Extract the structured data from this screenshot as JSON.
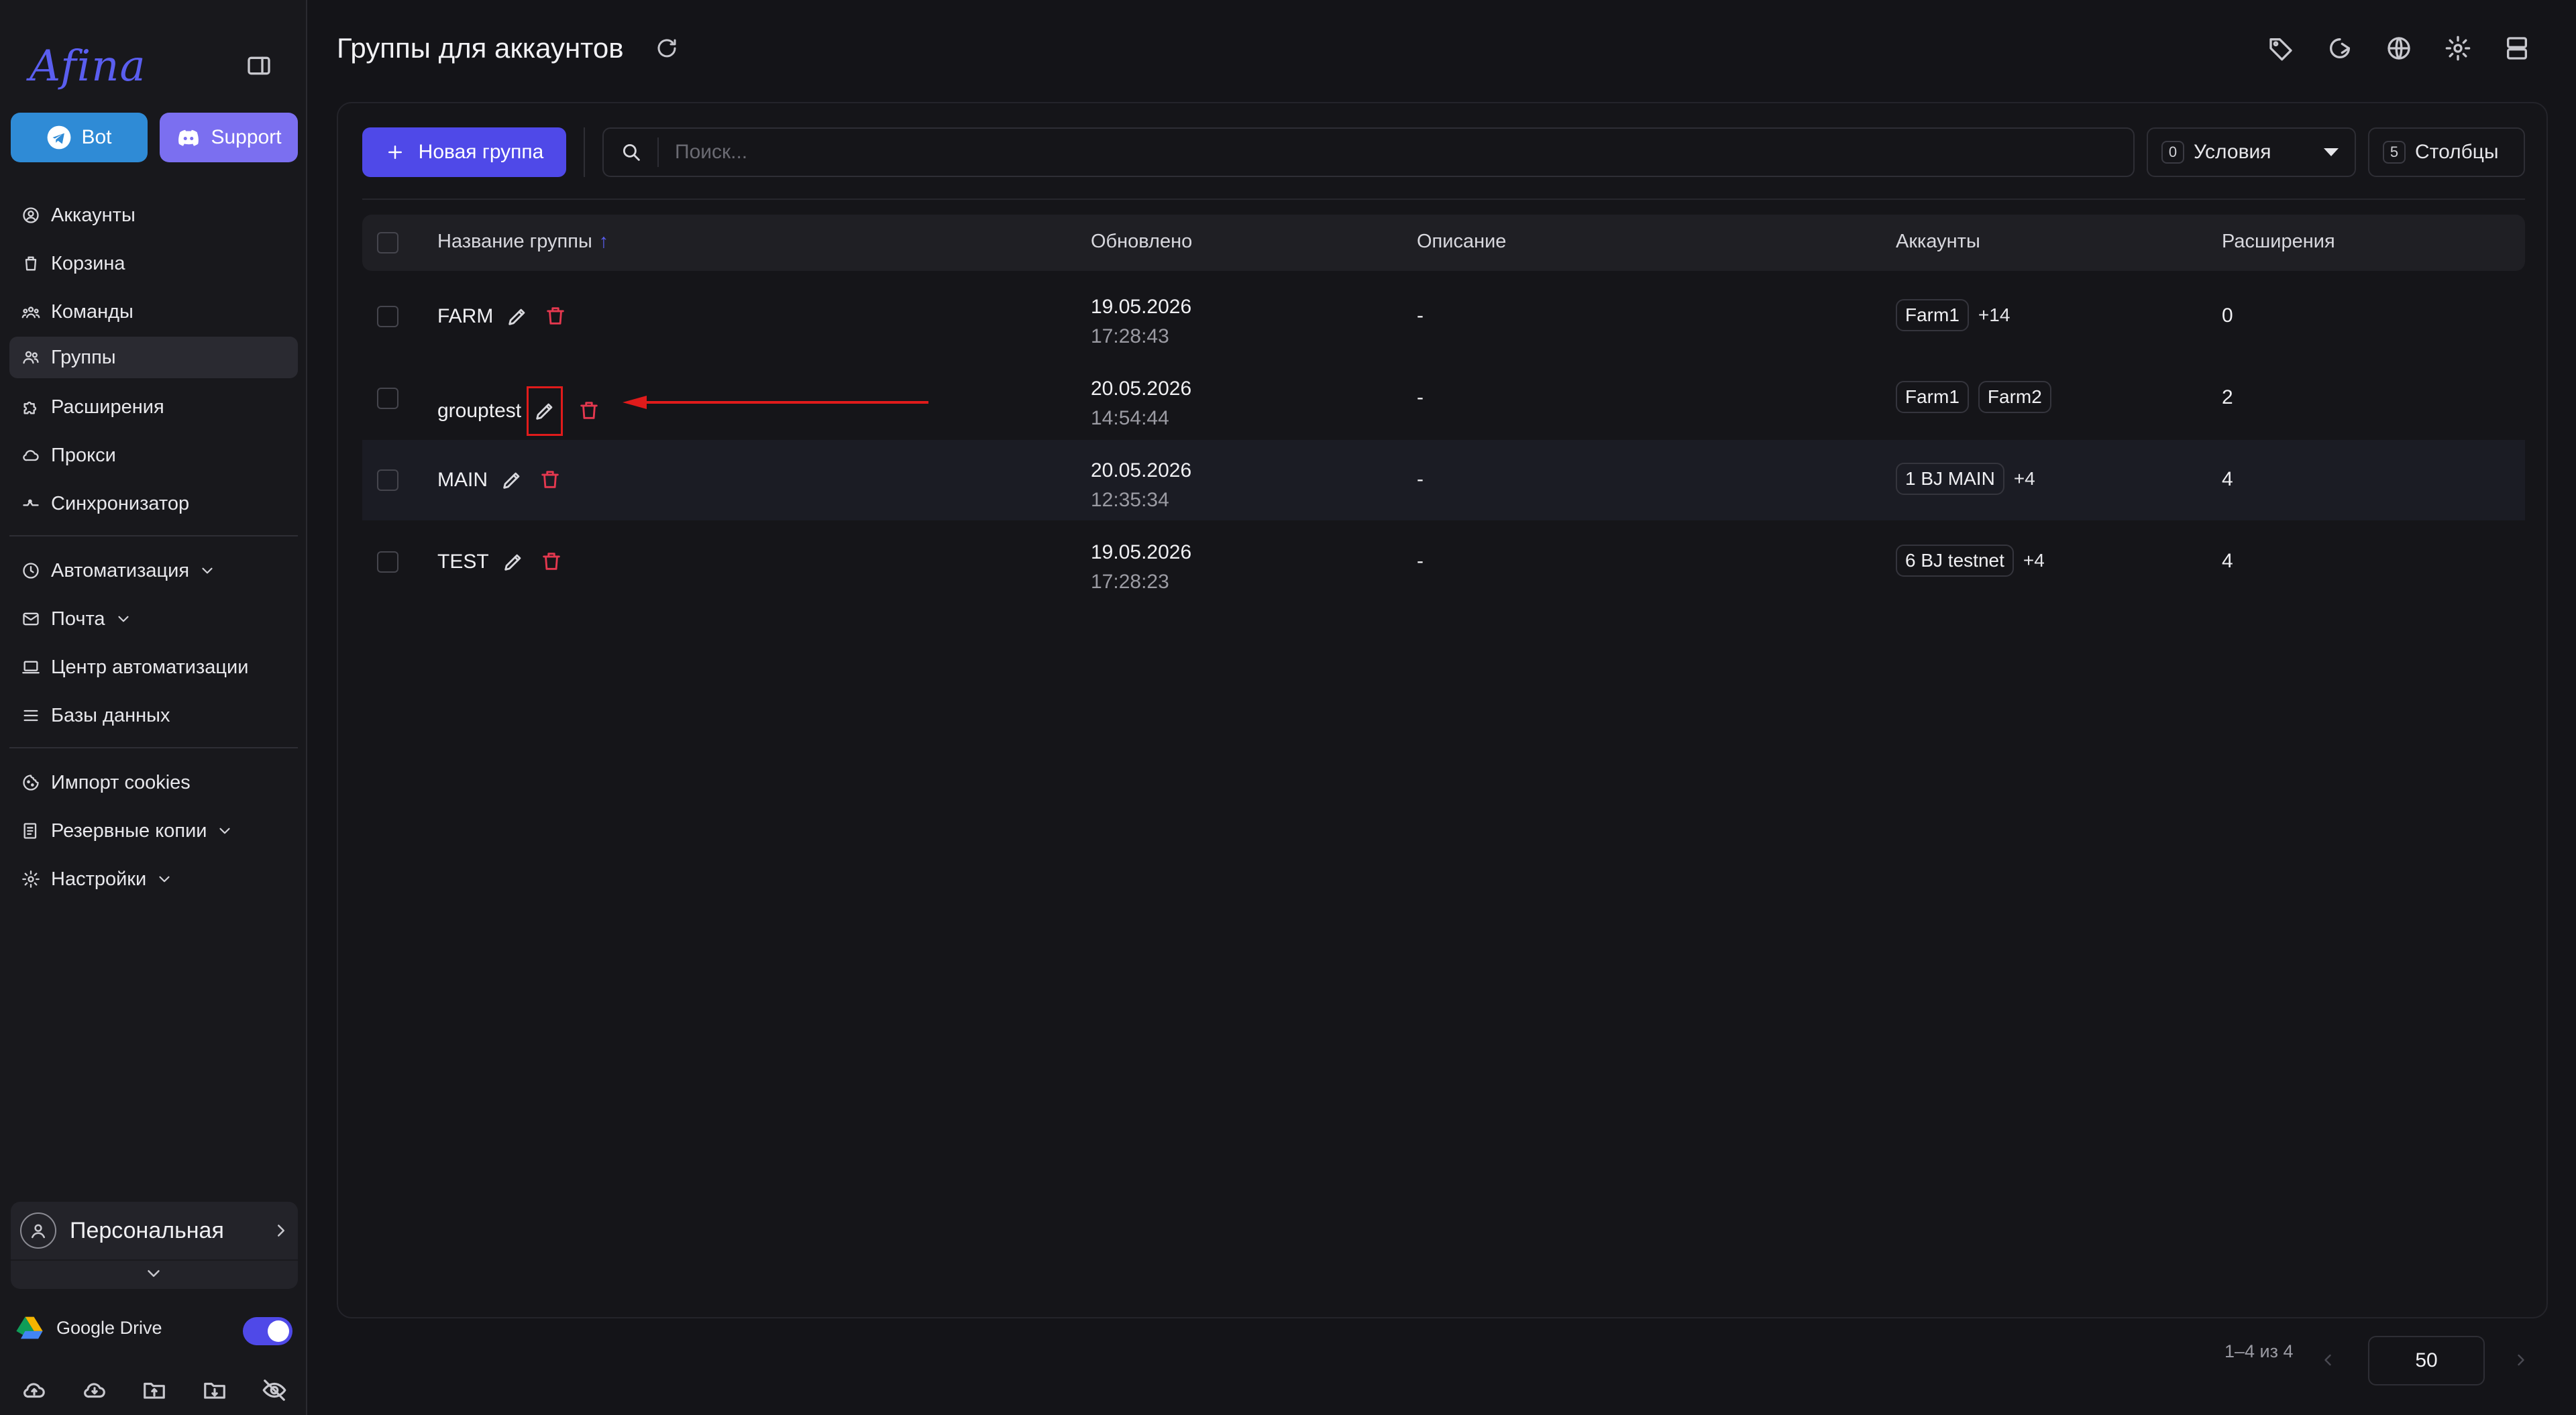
{
  "app": {
    "logo_text": "Afina",
    "bot_label": "Bot",
    "support_label": "Support"
  },
  "sidebar": {
    "items": [
      {
        "label": "Аккаунты",
        "icon": "user-circle-icon"
      },
      {
        "label": "Корзина",
        "icon": "trash-icon"
      },
      {
        "label": "Команды",
        "icon": "team-icon"
      },
      {
        "label": "Группы",
        "icon": "users-icon",
        "active": true
      },
      {
        "label": "Расширения",
        "icon": "puzzle-icon"
      },
      {
        "label": "Прокси",
        "icon": "cloud-icon"
      },
      {
        "label": "Синхронизатор",
        "icon": "sync-icon"
      },
      {
        "label": "Автоматизация",
        "icon": "automation-icon",
        "expandable": true
      },
      {
        "label": "Почта",
        "icon": "mail-icon",
        "expandable": true
      },
      {
        "label": "Центр автоматизации",
        "icon": "laptop-icon"
      },
      {
        "label": "Базы данных",
        "icon": "list-icon"
      },
      {
        "label": "Импорт cookies",
        "icon": "cookie-icon"
      },
      {
        "label": "Резервные копии",
        "icon": "backup-icon",
        "expandable": true
      },
      {
        "label": "Настройки",
        "icon": "gear-icon",
        "expandable": true
      }
    ],
    "profile_name": "Персональная",
    "gdrive_label": "Google Drive",
    "gdrive_enabled": true
  },
  "header": {
    "title": "Группы для аккаунтов"
  },
  "toolbar": {
    "new_group_label": "Новая группа",
    "search_placeholder": "Поиск...",
    "conditions_count": "0",
    "conditions_label": "Условия",
    "columns_count": "5",
    "columns_label": "Столбцы"
  },
  "table": {
    "columns": [
      "Название группы",
      "Обновлено",
      "Описание",
      "Аккаунты",
      "Расширения"
    ],
    "sort_indicator": "↑",
    "rows": [
      {
        "name": "FARM",
        "date": "19.05.2026",
        "time": "17:28:43",
        "description": "-",
        "accounts": [
          "Farm1"
        ],
        "more": "+14",
        "extensions": "0"
      },
      {
        "name": "grouptest",
        "date": "20.05.2026",
        "time": "14:54:44",
        "description": "-",
        "accounts": [
          "Farm1",
          "Farm2"
        ],
        "more": "",
        "extensions": "2"
      },
      {
        "name": "MAIN",
        "date": "20.05.2026",
        "time": "12:35:34",
        "description": "-",
        "accounts": [
          "1 BJ MAIN"
        ],
        "more": "+4",
        "extensions": "4"
      },
      {
        "name": "TEST",
        "date": "19.05.2026",
        "time": "17:28:23",
        "description": "-",
        "accounts": [
          "6 BJ testnet"
        ],
        "more": "+4",
        "extensions": "4"
      }
    ]
  },
  "pagination": {
    "range": "1–4 из 4",
    "per_page": "50"
  },
  "colors": {
    "accent": "#4f49e8",
    "bot": "#2f8bd6",
    "support": "#7b6ff0",
    "danger": "#e5384f",
    "highlight_box": "#e01b1b"
  }
}
